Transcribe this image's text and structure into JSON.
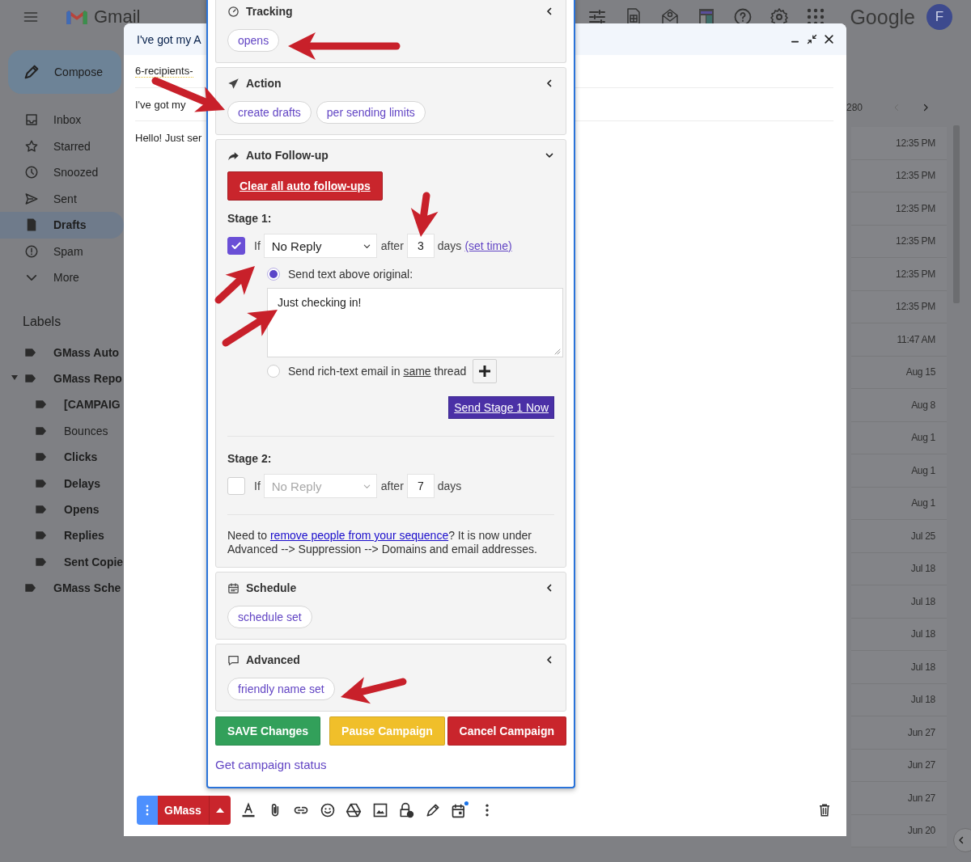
{
  "topbar": {
    "app_name": "Gmail",
    "brand": "Google",
    "avatar_initial": "F"
  },
  "sidebar": {
    "compose": "Compose",
    "nav": [
      {
        "label": "Inbox",
        "selected": false
      },
      {
        "label": "Starred",
        "selected": false
      },
      {
        "label": "Snoozed",
        "selected": false
      },
      {
        "label": "Sent",
        "selected": false
      },
      {
        "label": "Drafts",
        "selected": true
      },
      {
        "label": "Spam",
        "selected": false
      },
      {
        "label": "More",
        "selected": false
      }
    ],
    "labels_title": "Labels",
    "labels": [
      {
        "label": "GMass Auto",
        "unread": true,
        "expanded": false
      },
      {
        "label": "GMass Repo",
        "unread": true,
        "expanded": true,
        "children": [
          {
            "label": "[CAMPAIG",
            "unread": true
          },
          {
            "label": "Bounces",
            "unread": false
          },
          {
            "label": "Clicks",
            "unread": true
          },
          {
            "label": "Delays",
            "unread": true
          },
          {
            "label": "Opens",
            "unread": true
          },
          {
            "label": "Replies",
            "unread": true
          },
          {
            "label": "Sent Copie",
            "unread": true
          }
        ]
      },
      {
        "label": "GMass Sche",
        "unread": true,
        "expanded": false
      }
    ]
  },
  "message_list": {
    "count": "280",
    "dates": [
      "12:35 PM",
      "12:35 PM",
      "12:35 PM",
      "12:35 PM",
      "12:35 PM",
      "12:35 PM",
      "11:47 AM",
      "Aug 15",
      "Aug 8",
      "Aug 1",
      "Aug 1",
      "Aug 1",
      "Jul 25",
      "Jul 18",
      "Jul 18",
      "Jul 18",
      "Jul 18",
      "Jul 18",
      "Jun 27",
      "Jun 27",
      "Jun 27",
      "Jun 20"
    ]
  },
  "compose": {
    "title": "I've got my A",
    "recipients": "6-recipients-",
    "subject": "I've got my",
    "body": "Hello! Just ser",
    "send_label": "GMass"
  },
  "gmass": {
    "sections": [
      {
        "kind": "chips",
        "title": "Tracking",
        "expanded": false,
        "chips": [
          "opens"
        ]
      },
      {
        "kind": "chips",
        "title": "Action",
        "expanded": false,
        "chips": [
          "create drafts",
          "per sending limits"
        ]
      },
      {
        "kind": "followup",
        "title": "Auto Follow-up",
        "expanded": true,
        "clear_button": "Clear all auto follow-ups",
        "stages": [
          {
            "title": "Stage 1:",
            "checked": true,
            "if_label": "If",
            "condition": "No Reply",
            "after_label": "after",
            "days": "3",
            "days_label": "days",
            "set_time": "(set time)",
            "options": [
              {
                "kind": "text",
                "selected": true,
                "label": "Send text above original:",
                "text": "Just checking in!"
              },
              {
                "kind": "thread",
                "selected": false,
                "label_before": "Send rich-text email in",
                "label_underlined": "same",
                "label_after": "thread"
              }
            ],
            "send_now": "Send Stage 1 Now"
          },
          {
            "title": "Stage 2:",
            "checked": false,
            "if_label": "If",
            "condition": "No Reply",
            "after_label": "after",
            "days": "7",
            "days_label": "days"
          }
        ],
        "note": {
          "text_before": "Need to",
          "link": "remove people from your sequence",
          "text_after": "? It is now under Advanced --> Suppression --> Domains and email addresses."
        }
      },
      {
        "kind": "chips",
        "title": "Schedule",
        "expanded": false,
        "chips": [
          "schedule set"
        ]
      },
      {
        "kind": "chips",
        "title": "Advanced",
        "expanded": false,
        "chips": [
          "friendly name set"
        ]
      }
    ],
    "buttons": [
      {
        "kind": "save",
        "label": "SAVE Changes"
      },
      {
        "kind": "pause",
        "label": "Pause Campaign"
      },
      {
        "kind": "cancel",
        "label": "Cancel Campaign"
      }
    ],
    "status_link": "Get campaign status"
  }
}
